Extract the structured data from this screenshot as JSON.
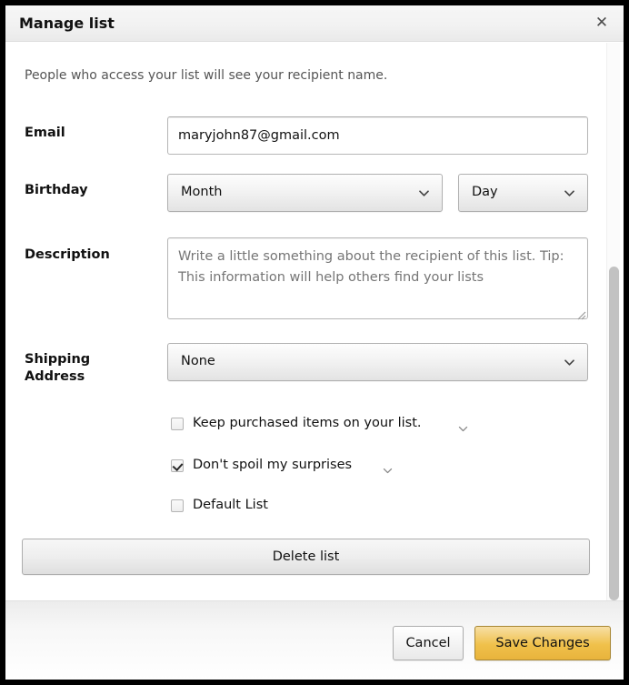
{
  "dialog": {
    "title": "Manage list",
    "close_icon": "close-icon",
    "intro": "People who access your list will see your recipient name."
  },
  "form": {
    "email": {
      "label": "Email",
      "value": "maryjohn87@gmail.com",
      "placeholder": ""
    },
    "birthday": {
      "label": "Birthday",
      "month": {
        "value": "Month",
        "chevron": "chevron-down-icon"
      },
      "day": {
        "value": "Day",
        "chevron": "chevron-down-icon"
      }
    },
    "description": {
      "label": "Description",
      "value": "",
      "placeholder": "Write a little something about the recipient of this list. Tip: This information will help others find your lists"
    },
    "shipping_address": {
      "label": "Shipping Address",
      "label_line1": "Shipping",
      "label_line2": "Address",
      "value": "None",
      "chevron": "chevron-down-icon"
    }
  },
  "options": [
    {
      "label": "Keep purchased items on your list.",
      "checked": false,
      "has_expander": true
    },
    {
      "label": "Don't spoil my surprises",
      "checked": true,
      "has_expander": true
    },
    {
      "label": "Default List",
      "checked": false,
      "has_expander": false
    }
  ],
  "actions": {
    "delete": "Delete list",
    "cancel": "Cancel",
    "save": "Save Changes"
  },
  "scrollbar": {
    "orientation": "vertical",
    "thumb_position_percent": 40
  },
  "colors": {
    "accent": "#f0c14b",
    "accent_border": "#a88734",
    "text": "#111111",
    "muted_text": "#757575",
    "header_bg": "#f2f2f2",
    "scroll_thumb": "#c2c2c2"
  }
}
